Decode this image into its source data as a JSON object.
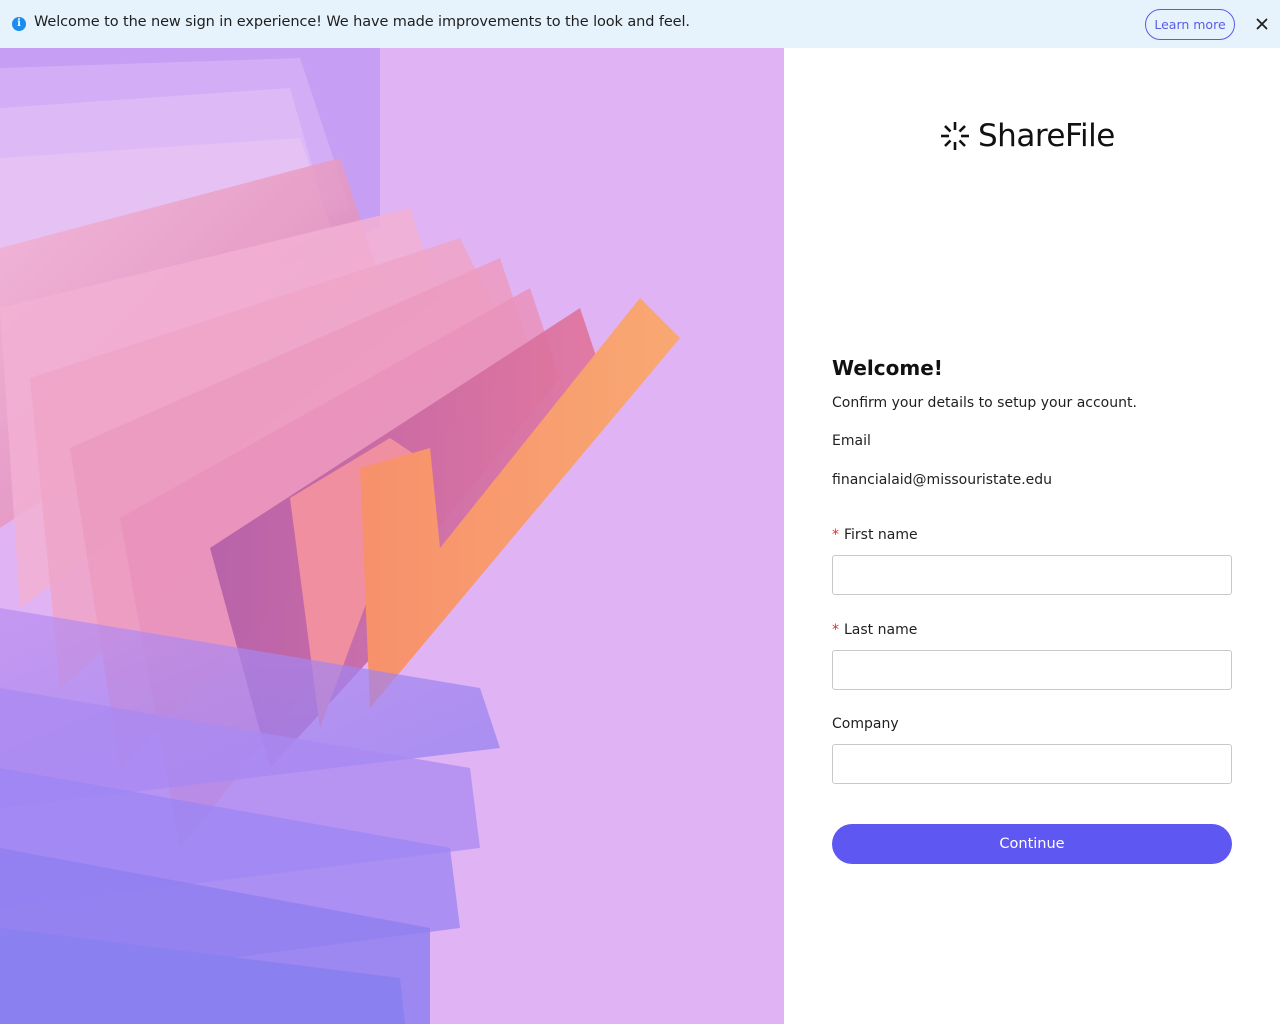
{
  "banner": {
    "message": "Welcome to the new sign in experience! We have made improvements to the look and feel.",
    "learn_more_label": "Learn more",
    "icon": "info-icon",
    "close_icon": "close-icon"
  },
  "brand": {
    "name": "ShareFile",
    "icon": "sharefile-logo-icon",
    "accent": "#5e57f2"
  },
  "form": {
    "title": "Welcome!",
    "subtitle": "Confirm your details to setup your account.",
    "email_label": "Email",
    "email_value": "financialaid@missouristate.edu",
    "required_marker": "*",
    "first_name_label": "First name",
    "first_name_value": "",
    "last_name_label": "Last name",
    "last_name_value": "",
    "company_label": "Company",
    "company_value": "",
    "continue_label": "Continue"
  },
  "colors": {
    "banner_bg": "#e6f3fd",
    "art_bg": "#e0b4f4",
    "required": "#d93025",
    "button": "#5e57f2"
  }
}
